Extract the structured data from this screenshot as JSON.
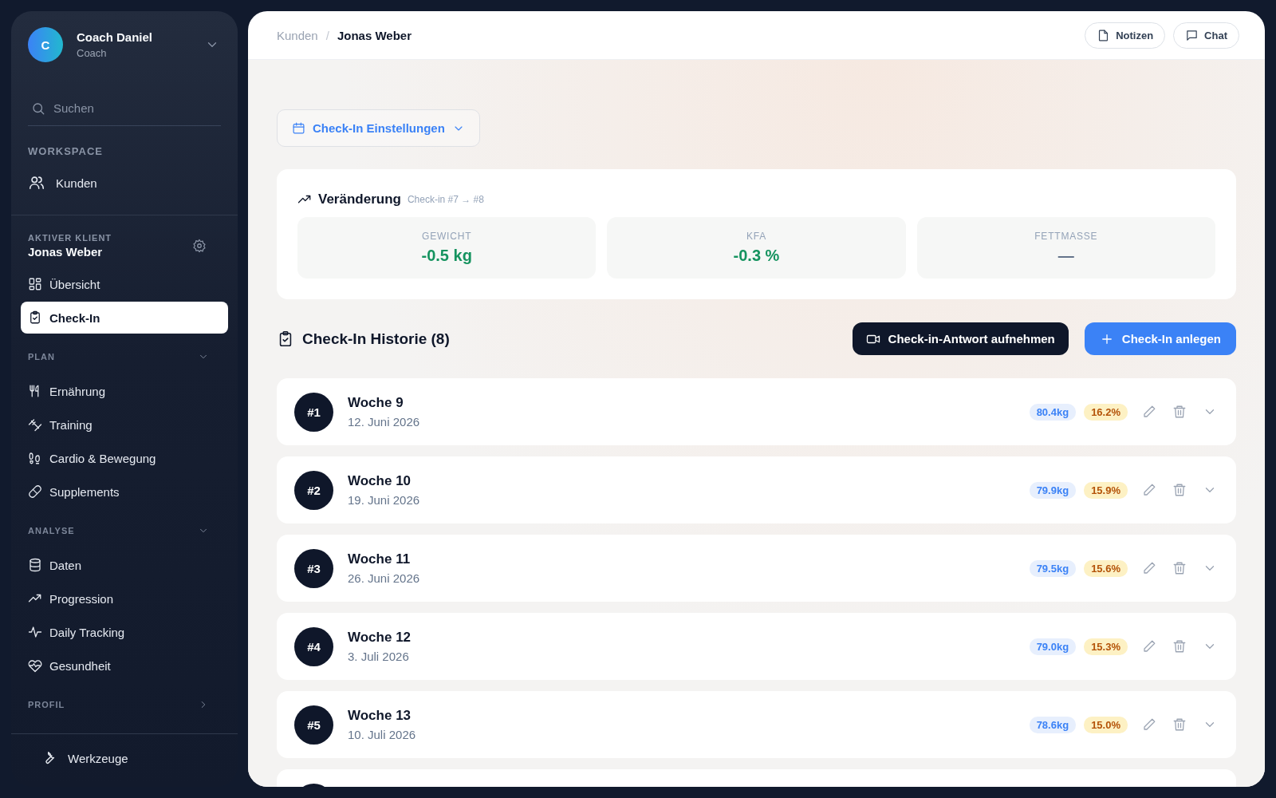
{
  "profile": {
    "initial": "C",
    "name": "Coach Daniel",
    "role": "Coach"
  },
  "search": {
    "placeholder": "Suchen"
  },
  "workspace": {
    "label": "WORKSPACE",
    "items": [
      {
        "label": "Kunden",
        "selected": false
      }
    ]
  },
  "client": {
    "label": "AKTIVER KLIENT",
    "name": "Jonas Weber",
    "items": [
      {
        "label": "Übersicht",
        "selected": false
      },
      {
        "label": "Check-In",
        "selected": true
      }
    ]
  },
  "sections": [
    {
      "label": "PLAN",
      "expanded": true,
      "items": [
        {
          "label": "Ernährung",
          "selected": false
        },
        {
          "label": "Training",
          "selected": false
        },
        {
          "label": "Cardio & Bewegung",
          "selected": false
        },
        {
          "label": "Supplements",
          "selected": false
        }
      ]
    },
    {
      "label": "ANALYSE",
      "expanded": true,
      "items": [
        {
          "label": "Daten",
          "selected": false
        },
        {
          "label": "Progression",
          "selected": false
        },
        {
          "label": "Daily Tracking",
          "selected": false
        },
        {
          "label": "Gesundheit",
          "selected": false
        }
      ]
    },
    {
      "label": "PROFIL",
      "expanded": false
    }
  ],
  "footer_item": {
    "label": "Werkzeuge"
  },
  "breadcrumb": [
    "Kunden",
    "/",
    "Jonas Weber"
  ],
  "header_buttons": [
    "Notizen",
    "Chat"
  ],
  "settings_button": "Check-In Einstellungen",
  "change": {
    "title": "Veränderung",
    "subtitle": "Check-in #7 → #8",
    "stats": [
      {
        "label": "GEWICHT",
        "value": "-0.5 kg",
        "color": "#15935f"
      },
      {
        "label": "KFA",
        "value": "-0.3 %",
        "color": "#15935f"
      },
      {
        "label": "FETTMASSE",
        "value": "—",
        "color": "#64748b"
      }
    ]
  },
  "history": {
    "title": "Check-In Historie (8)",
    "record_button": "Check-in-Antwort aufnehmen",
    "add_button": "Check-In anlegen",
    "rows": [
      {
        "number": "#1",
        "title": "Woche 9",
        "date": "12. Juni 2026",
        "weight": "80.4kg",
        "kfa": "16.2%"
      },
      {
        "number": "#2",
        "title": "Woche 10",
        "date": "19. Juni 2026",
        "weight": "79.9kg",
        "kfa": "15.9%"
      },
      {
        "number": "#3",
        "title": "Woche 11",
        "date": "26. Juni 2026",
        "weight": "79.5kg",
        "kfa": "15.6%"
      },
      {
        "number": "#4",
        "title": "Woche 12",
        "date": "3. Juli 2026",
        "weight": "79.0kg",
        "kfa": "15.3%"
      },
      {
        "number": "#5",
        "title": "Woche 13",
        "date": "10. Juli 2026",
        "weight": "78.6kg",
        "kfa": "15.0%"
      }
    ]
  }
}
